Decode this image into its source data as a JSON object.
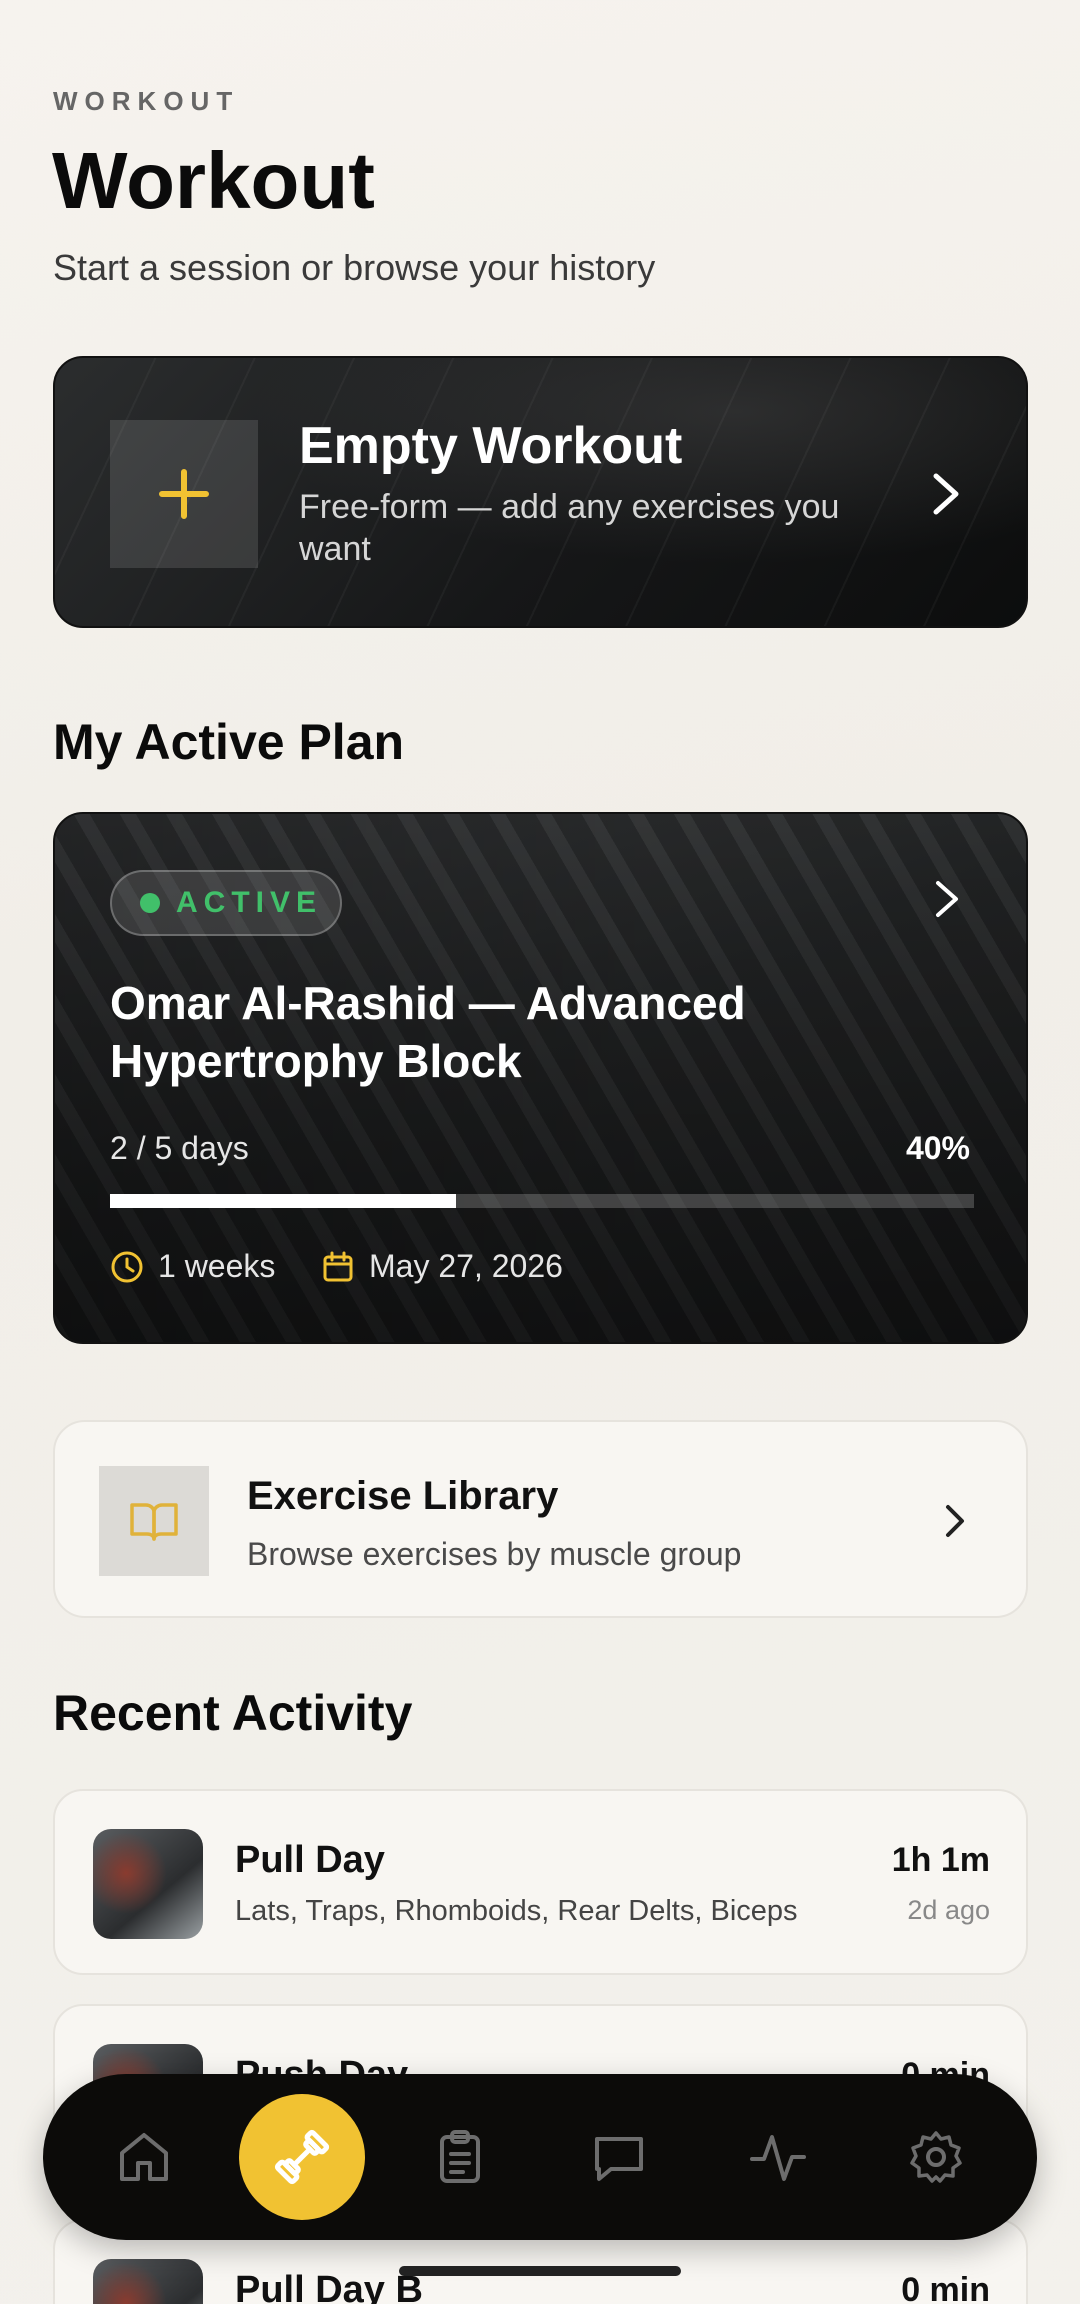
{
  "header": {
    "eyebrow": "WORKOUT",
    "title": "Workout",
    "subtitle": "Start a session or browse your history"
  },
  "empty_workout": {
    "title": "Empty Workout",
    "description": "Free-form — add any exercises you want"
  },
  "active_plan": {
    "section_title": "My Active Plan",
    "badge": "ACTIVE",
    "title": "Omar Al-Rashid — Advanced Hypertrophy Block",
    "days": "2 / 5 days",
    "percent_label": "40%",
    "progress": 0.4,
    "duration": "1 weeks",
    "date": "May 27, 2026"
  },
  "library": {
    "title": "Exercise Library",
    "description": "Browse exercises by muscle group"
  },
  "recent": {
    "section_title": "Recent Activity",
    "items": [
      {
        "name": "Pull Day",
        "muscles": "Lats, Traps, Rhomboids, Rear Delts, Biceps",
        "duration": "1h 1m",
        "ago": "2d ago"
      },
      {
        "name": "Push Day",
        "muscles": "",
        "duration": "0 min",
        "ago": ""
      },
      {
        "name": "Pull Day B",
        "muscles": "",
        "duration": "0 min",
        "ago": ""
      }
    ]
  },
  "nav": {
    "items": [
      "home-icon",
      "dumbbell-icon",
      "clipboard-icon",
      "chat-icon",
      "activity-icon",
      "gear-icon"
    ],
    "active": "dumbbell-icon"
  },
  "colors": {
    "accent": "#f1c232",
    "active_green": "#41c06a",
    "nav_bg": "#0c0b09"
  }
}
